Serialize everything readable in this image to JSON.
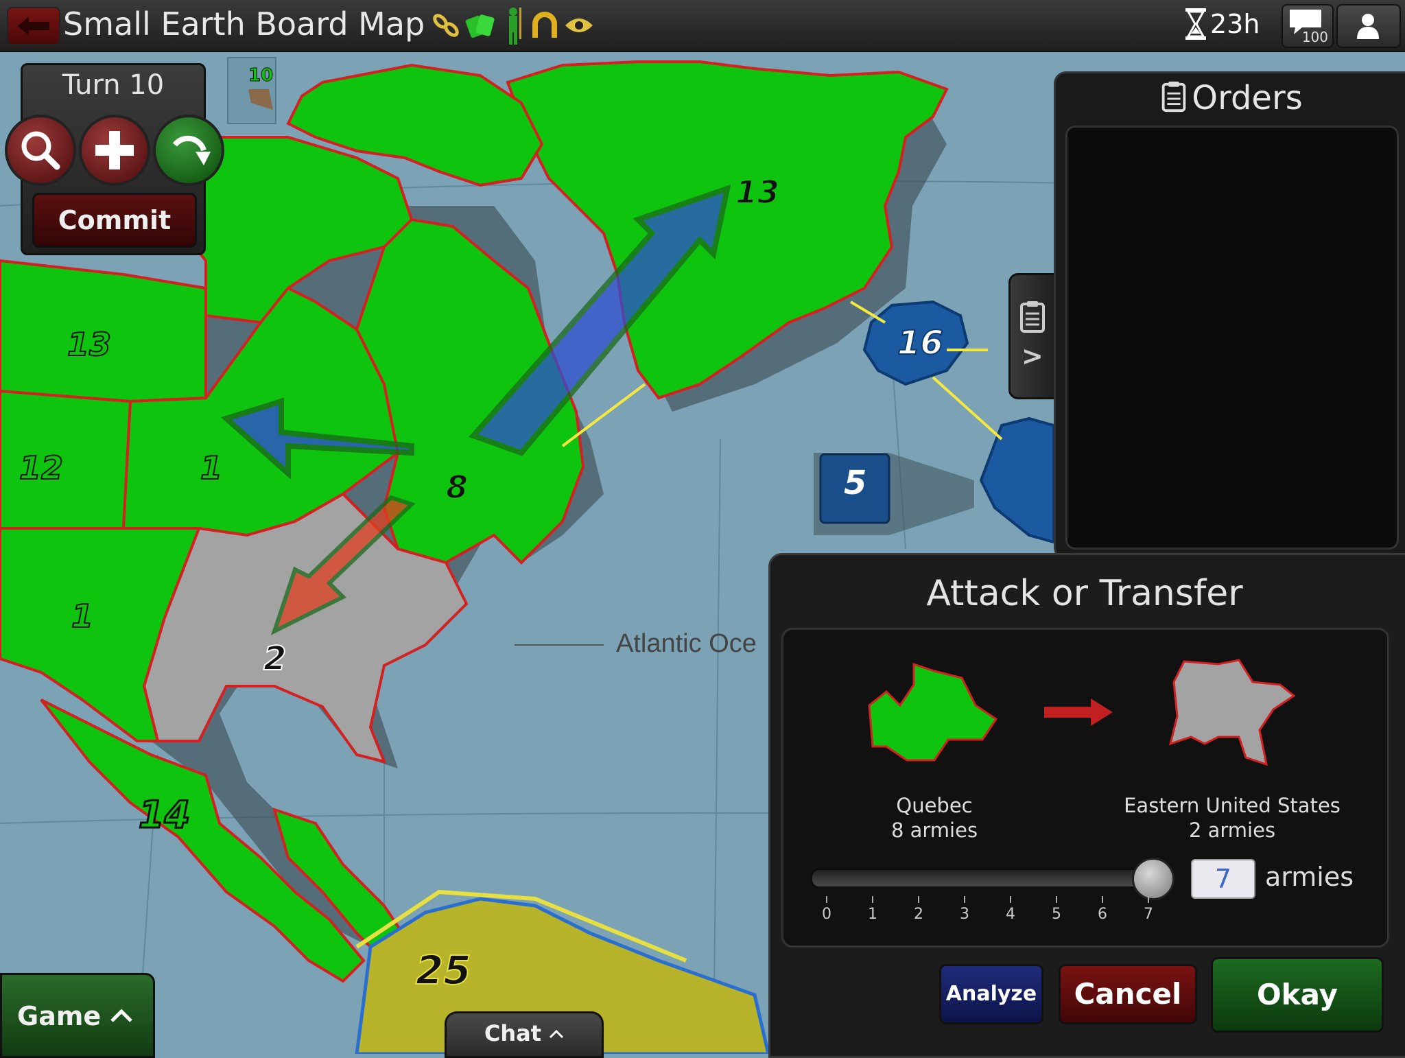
{
  "header": {
    "title": "Small Earth Board Map",
    "timer": "23h",
    "chat_count": "100",
    "icons": [
      "link-icon",
      "cards-icon",
      "commander-icon",
      "horseshoe-icon",
      "eye-icon"
    ]
  },
  "turn_panel": {
    "turn_label": "Turn 10",
    "commit_label": "Commit"
  },
  "map": {
    "ocean_label": "Atlantic Oce",
    "card_count": "10",
    "armies": [
      "13",
      "13",
      "12",
      "1",
      "8",
      "1",
      "2",
      "14",
      "16",
      "5",
      "25"
    ]
  },
  "orders": {
    "title": "Orders",
    "tab_label": ">"
  },
  "dialog": {
    "title": "Attack or Transfer",
    "from_territory": "Quebec",
    "from_armies": "8 armies",
    "to_territory": "Eastern United States",
    "to_armies": "2 armies",
    "slider_ticks": [
      "0",
      "1",
      "2",
      "3",
      "4",
      "5",
      "6",
      "7"
    ],
    "slider_value": 7,
    "armies_value": "7",
    "armies_unit": "armies",
    "analyze_label": "Analyze",
    "cancel_label": "Cancel",
    "okay_label": "Okay"
  },
  "bottom": {
    "game_label": "Game",
    "chat_label": "Chat"
  },
  "colors": {
    "player_green": "#0ec40e",
    "player_blue": "#1b5aa0",
    "neutral_gray": "#a3a3a3",
    "south_america_yellow": "#b7b32a",
    "ocean": "#7ba3b5",
    "border_red": "#d32020"
  }
}
